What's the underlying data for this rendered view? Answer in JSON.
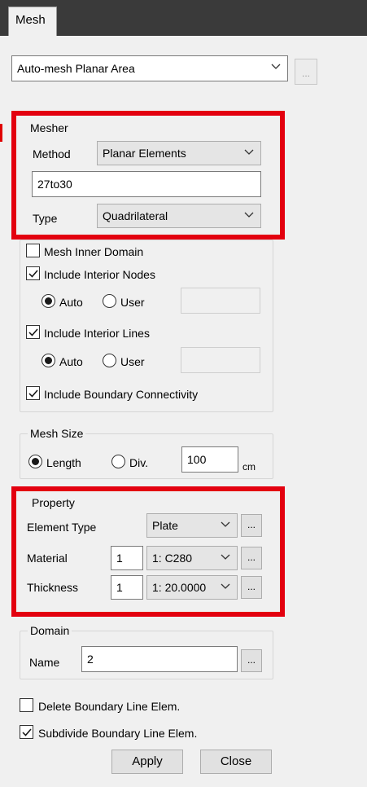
{
  "tab": {
    "label": "Mesh"
  },
  "command": {
    "selected": "Auto-mesh Planar Area",
    "more": "..."
  },
  "mesher": {
    "title": "Mesher",
    "method_label": "Method",
    "method_value": "Planar Elements",
    "name_value": "27to30",
    "type_label": "Type",
    "type_value": "Quadrilateral"
  },
  "options": {
    "mesh_inner_domain": "Mesh Inner Domain",
    "include_interior_nodes": "Include Interior Nodes",
    "nodes_auto": "Auto",
    "nodes_user": "User",
    "include_interior_lines": "Include Interior Lines",
    "lines_auto": "Auto",
    "lines_user": "User",
    "include_boundary_connectivity": "Include Boundary Connectivity"
  },
  "mesh_size": {
    "title": "Mesh Size",
    "length_label": "Length",
    "div_label": "Div.",
    "value": "100",
    "unit": "cm"
  },
  "property": {
    "title": "Property",
    "element_type_label": "Element Type",
    "element_type_value": "Plate",
    "material_label": "Material",
    "material_number": "1",
    "material_value": "1: C280",
    "thickness_label": "Thickness",
    "thickness_number": "1",
    "thickness_value": "1: 20.0000",
    "more": "..."
  },
  "domain": {
    "title": "Domain",
    "name_label": "Name",
    "name_value": "2",
    "more": "..."
  },
  "bottom": {
    "delete_boundary": "Delete Boundary Line Elem.",
    "subdivide_boundary": "Subdivide Boundary Line Elem.",
    "apply": "Apply",
    "close": "Close"
  },
  "colors": {
    "highlight": "#e3000f",
    "panel": "#f0f0f0"
  }
}
